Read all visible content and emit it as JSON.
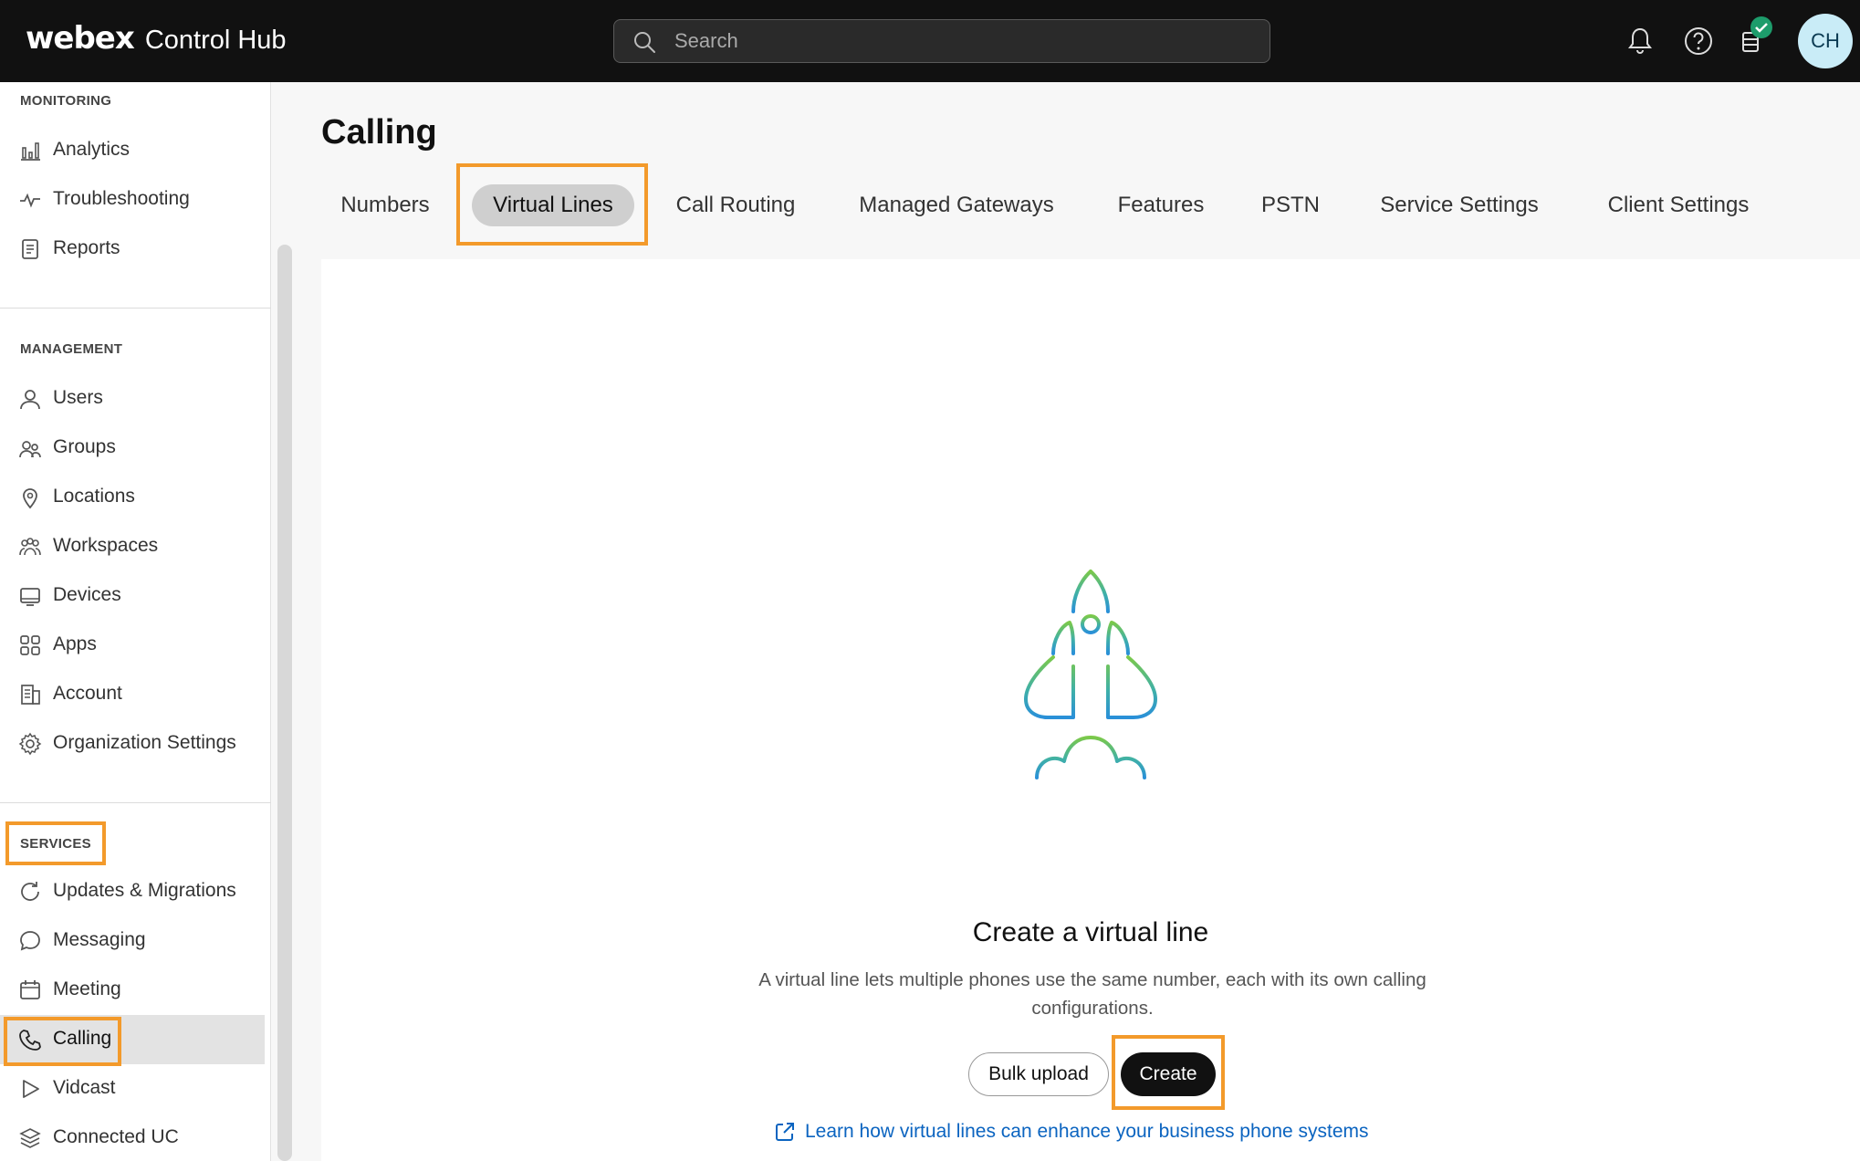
{
  "header": {
    "brand_webex": "webex",
    "brand_product": "Control Hub",
    "search_placeholder": "Search",
    "avatar_initials": "CH"
  },
  "sidebar": {
    "monitoring_title": "MONITORING",
    "monitoring_items": [
      {
        "label": "Analytics",
        "icon": "analytics-icon"
      },
      {
        "label": "Troubleshooting",
        "icon": "troubleshooting-icon"
      },
      {
        "label": "Reports",
        "icon": "reports-icon"
      }
    ],
    "management_title": "MANAGEMENT",
    "management_items": [
      {
        "label": "Users",
        "icon": "user-icon"
      },
      {
        "label": "Groups",
        "icon": "groups-icon"
      },
      {
        "label": "Locations",
        "icon": "location-pin-icon"
      },
      {
        "label": "Workspaces",
        "icon": "workspaces-icon"
      },
      {
        "label": "Devices",
        "icon": "devices-icon"
      },
      {
        "label": "Apps",
        "icon": "apps-grid-icon"
      },
      {
        "label": "Account",
        "icon": "account-icon"
      },
      {
        "label": "Organization Settings",
        "icon": "gear-icon"
      }
    ],
    "services_title": "SERVICES",
    "services_items": [
      {
        "label": "Updates & Migrations",
        "icon": "refresh-icon"
      },
      {
        "label": "Messaging",
        "icon": "chat-bubble-icon"
      },
      {
        "label": "Meeting",
        "icon": "calendar-icon"
      },
      {
        "label": "Calling",
        "icon": "phone-icon",
        "active": true
      },
      {
        "label": "Vidcast",
        "icon": "play-icon"
      },
      {
        "label": "Connected UC",
        "icon": "stack-icon"
      }
    ]
  },
  "main": {
    "title": "Calling",
    "tabs": [
      {
        "label": "Numbers"
      },
      {
        "label": "Virtual Lines",
        "active": true
      },
      {
        "label": "Call Routing"
      },
      {
        "label": "Managed Gateways"
      },
      {
        "label": "Features"
      },
      {
        "label": "PSTN"
      },
      {
        "label": "Service Settings"
      },
      {
        "label": "Client Settings"
      }
    ],
    "empty_state": {
      "illustration": "rocket-icon",
      "title": "Create a virtual line",
      "description": "A virtual line lets multiple phones use the same number, each with its own calling configurations.",
      "bulk_upload_label": "Bulk upload",
      "create_label": "Create",
      "learn_link": "Learn how virtual lines can enhance your business phone systems"
    }
  },
  "colors": {
    "topbar": "#111111",
    "highlight": "#f39a2b",
    "link": "#0b64c0",
    "primary_button": "#111111"
  }
}
